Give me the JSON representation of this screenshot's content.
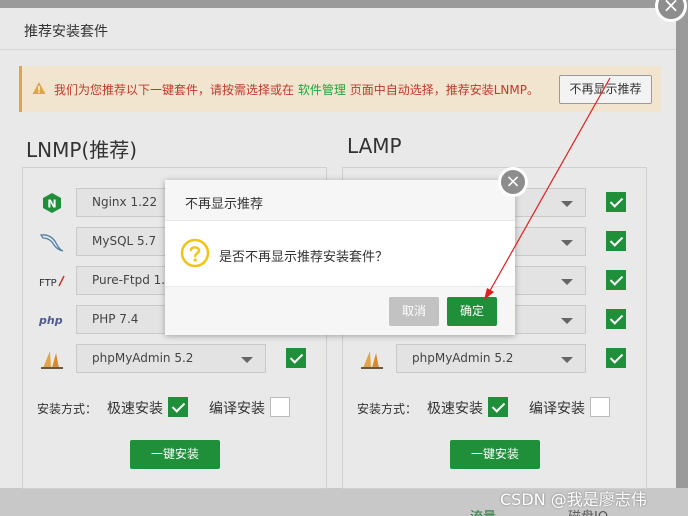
{
  "main_dialog": {
    "title": "推荐安装套件",
    "close_glyph": "×"
  },
  "notice": {
    "text_before": "我们为您推荐以下一键套件，请按需选择或在",
    "link": "软件管理",
    "text_after": "页面中自动选择，推荐安装LNMP。",
    "button": "不再显示推荐",
    "accent_color": "#e0a44a"
  },
  "lnmp": {
    "title": "LNMP(推荐)",
    "rows": [
      {
        "icon": "nginx-icon",
        "value": "Nginx 1.22",
        "checked": true
      },
      {
        "icon": "mysql-icon",
        "value": "MySQL 5.7",
        "checked": true
      },
      {
        "icon": "ftp-icon",
        "value": "Pure-Ftpd 1.0",
        "checked": true
      },
      {
        "icon": "php-icon",
        "value": "PHP 7.4",
        "checked": true
      },
      {
        "icon": "phpmyadmin-icon",
        "value": "phpMyAdmin 5.2",
        "checked": true
      }
    ],
    "method_label": "安装方式：",
    "option_fast": "极速安装",
    "option_compile": "编译安装",
    "install_button": "一键安装"
  },
  "lamp": {
    "title": "LAMP",
    "rows": [
      {
        "icon": "apache-icon",
        "value": "",
        "checked": true
      },
      {
        "icon": "mysql-icon",
        "value": "",
        "checked": true
      },
      {
        "icon": "ftp-icon",
        "value": "",
        "checked": true
      },
      {
        "icon": "php-icon",
        "value": "",
        "checked": true
      },
      {
        "icon": "phpmyadmin-icon",
        "value": "phpMyAdmin 5.2",
        "checked": true
      }
    ],
    "method_label": "安装方式：",
    "option_fast": "极速安装",
    "option_compile": "编译安装",
    "install_button": "一键安装"
  },
  "confirm": {
    "title": "不再显示推荐",
    "message": "是否不再显示推荐安装套件？",
    "cancel": "取消",
    "ok": "确定",
    "close_glyph": "×"
  },
  "background": {
    "text1": "流量",
    "text2": "磁盘IO"
  },
  "watermark": "CSDN @我是廖志伟",
  "colors": {
    "green": "#1f8f3a",
    "notice_text": "#c0392b",
    "arrow": "#e02020"
  }
}
